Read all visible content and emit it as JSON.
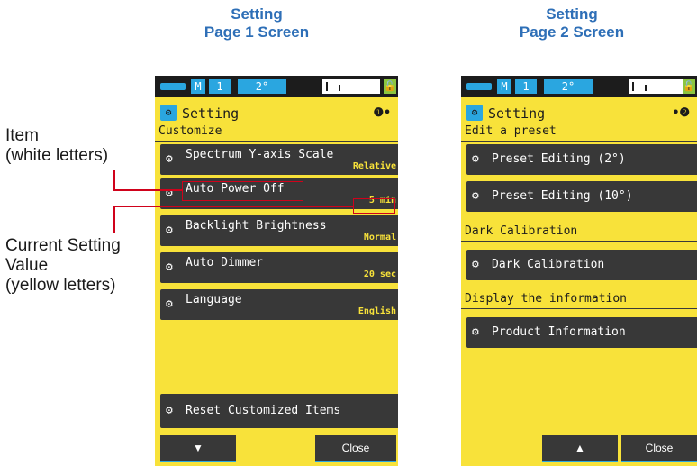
{
  "headings": {
    "page1": [
      "Setting",
      "Page 1 Screen"
    ],
    "page2": [
      "Setting",
      "Page 2 Screen"
    ]
  },
  "callouts": {
    "item": [
      "Item",
      "(white letters)"
    ],
    "current_value": [
      "Current Setting",
      "Value",
      "(yellow letters)"
    ]
  },
  "status_bar": {
    "mode": "M",
    "memory": "1",
    "angle": "2°"
  },
  "screen1": {
    "title": "Setting",
    "page_indicator": "❶•",
    "section": "Customize",
    "items": [
      {
        "label": "Spectrum Y-axis Scale",
        "value": "Relative"
      },
      {
        "label": "Auto Power Off",
        "value": "5 min"
      },
      {
        "label": "Backlight Brightness",
        "value": "Normal"
      },
      {
        "label": "Auto Dimmer",
        "value": "20 sec"
      },
      {
        "label": "Language",
        "value": "English"
      }
    ],
    "reset_label": "Reset Customized Items",
    "down_label": "▼",
    "close_label": "Close"
  },
  "screen2": {
    "title": "Setting",
    "page_indicator": "•❷",
    "sections": [
      {
        "label": "Edit a preset",
        "items": [
          "Preset Editing (2°)",
          "Preset Editing (10°)"
        ]
      },
      {
        "label": "Dark Calibration",
        "items": [
          "Dark Calibration"
        ]
      },
      {
        "label": "Display the information",
        "items": [
          "Product Information"
        ]
      }
    ],
    "up_label": "▲",
    "close_label": "Close"
  },
  "colors": {
    "screen_background": "#f8e23a",
    "item_background": "#383838",
    "item_text": "#ffffff",
    "value_text": "#f8e23a",
    "status_accent": "#2aa6e0",
    "heading": "#2e6fb7",
    "callout_lines": "#d0021b"
  },
  "icons": {
    "item_icon": "gears-icon",
    "title_icon": "setting-icon",
    "lock_icon": "lock-icon",
    "battery_icon": "battery-icon"
  }
}
